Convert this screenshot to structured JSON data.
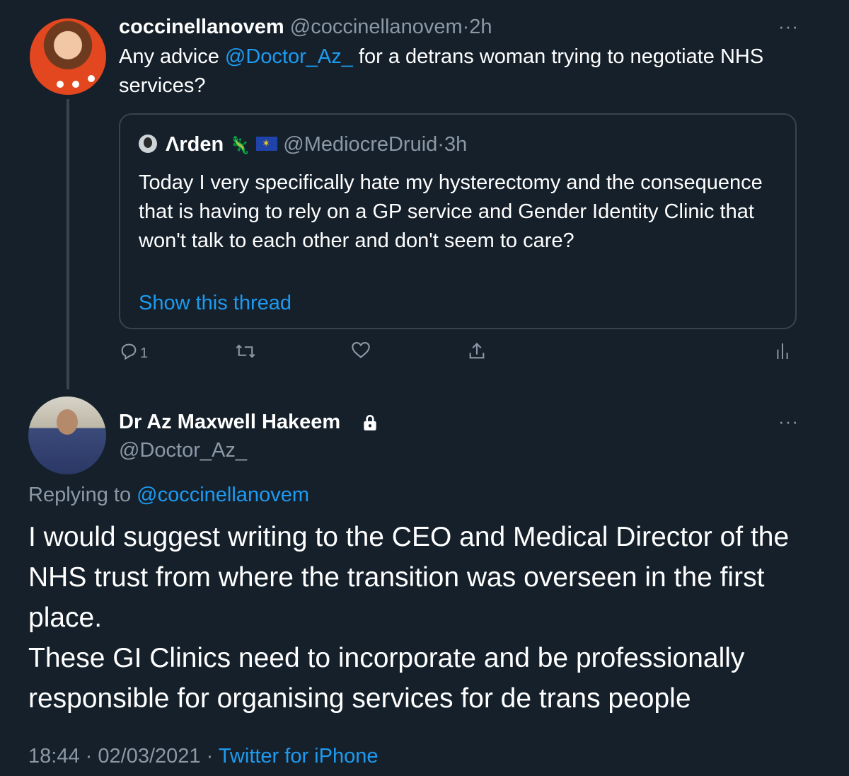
{
  "tweet1": {
    "name": "coccinellanovem",
    "handle": "@coccinellanovem",
    "dot": "·",
    "time": "2h",
    "more": "···",
    "text_before": "Any advice ",
    "mention": "@Doctor_Az_",
    "text_after": "  for a detrans woman trying to negotiate NHS services?",
    "reply_count": "1"
  },
  "quote": {
    "name": "Λrden",
    "emoji_gecko": "🦎",
    "handle": "@MediocreDruid",
    "dot": "·",
    "time": "3h",
    "text": "Today I very specifically hate my hysterectomy and the consequence that is having to rely on a GP service and Gender Identity Clinic that won't talk to each other and don't seem to care?",
    "show_thread": "Show this thread"
  },
  "tweet2": {
    "name": "Dr Az Maxwell Hakeem",
    "handle": "@Doctor_Az_",
    "more": "···",
    "replying_label": "Replying to ",
    "replying_to": "@coccinellanovem",
    "text_line1": "I would suggest writing to the CEO and Medical Director of the NHS trust from where the transition was overseen in the first place.",
    "text_line2": "These GI Clinics need to incorporate and be professionally responsible for organising services for de trans people",
    "time": "18:44",
    "dot": "·",
    "date": "02/03/2021",
    "source": "Twitter for iPhone"
  },
  "colors": {
    "background": "#15202b",
    "link": "#1d9bf0",
    "muted": "#8b98a5",
    "border": "#38444d"
  }
}
